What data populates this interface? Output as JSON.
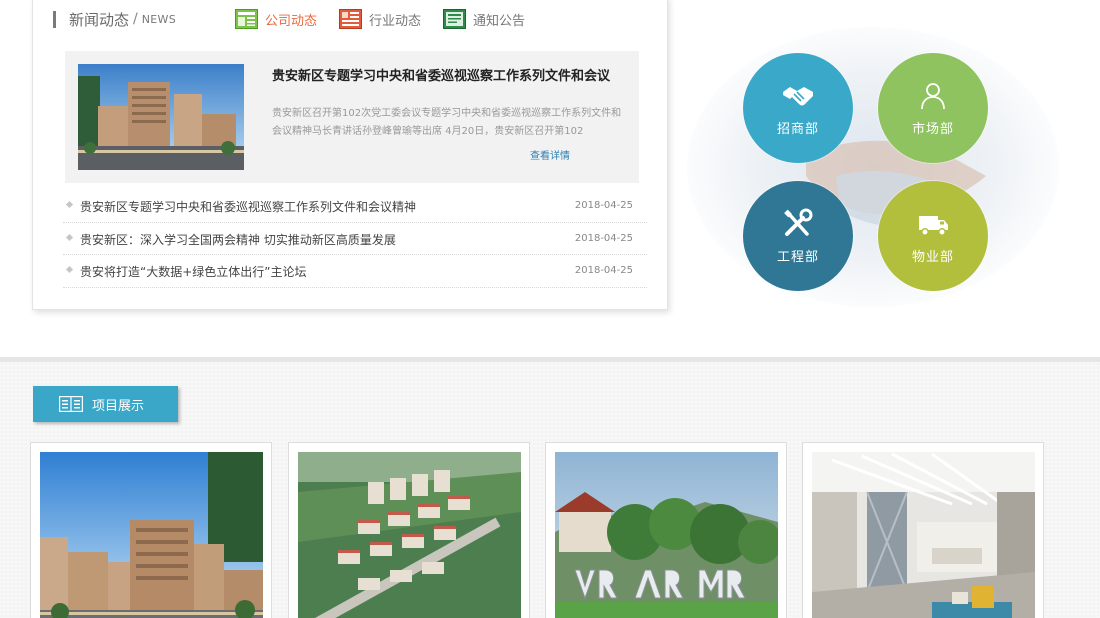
{
  "news": {
    "title": "新闻动态",
    "title_en": "NEWS",
    "tabs": [
      {
        "label": "公司动态",
        "icon": "news-grid-icon"
      },
      {
        "label": "行业动态",
        "icon": "news-list-icon"
      },
      {
        "label": "通知公告",
        "icon": "notice-icon"
      }
    ],
    "active_tab": 0,
    "feature": {
      "title": "贵安新区专题学习中央和省委巡视巡察工作系列文件和会议",
      "summary": "贵安新区召开第102次党工委会议专题学习中央和省委巡视巡察工作系列文件和会议精神马长青讲话孙登峰曾瑜等出席 4月20日，贵安新区召开第102",
      "more": "查看详情"
    },
    "items": [
      {
        "title": "贵安新区专题学习中央和省委巡视巡察工作系列文件和会议精神",
        "date": "2018-04-25"
      },
      {
        "title": "贵安新区：深入学习全国两会精神 切实推动新区高质量发展",
        "date": "2018-04-25"
      },
      {
        "title": "贵安将打造“大数据+绿色立体出行”主论坛",
        "date": "2018-04-25"
      }
    ]
  },
  "departments": [
    {
      "label": "招商部",
      "icon": "handshake-icon",
      "color": "#3aa9c9"
    },
    {
      "label": "市场部",
      "icon": "user-icon",
      "color": "#8fc35f"
    },
    {
      "label": "工程部",
      "icon": "tools-icon",
      "color": "#2f7794"
    },
    {
      "label": "物业部",
      "icon": "truck-icon",
      "color": "#b1bf3c"
    }
  ],
  "projects": {
    "label": "项目展示",
    "icon": "book-icon",
    "cards": [
      {
        "image": "hotel-building-photo"
      },
      {
        "image": "aerial-campus-photo"
      },
      {
        "image": "vr-ar-mr-park-photo"
      },
      {
        "image": "lobby-interior-photo"
      }
    ]
  },
  "colors": {
    "accent": "#3aa7c9",
    "active_tab": "#e86a3f",
    "link": "#2d7fb5"
  }
}
